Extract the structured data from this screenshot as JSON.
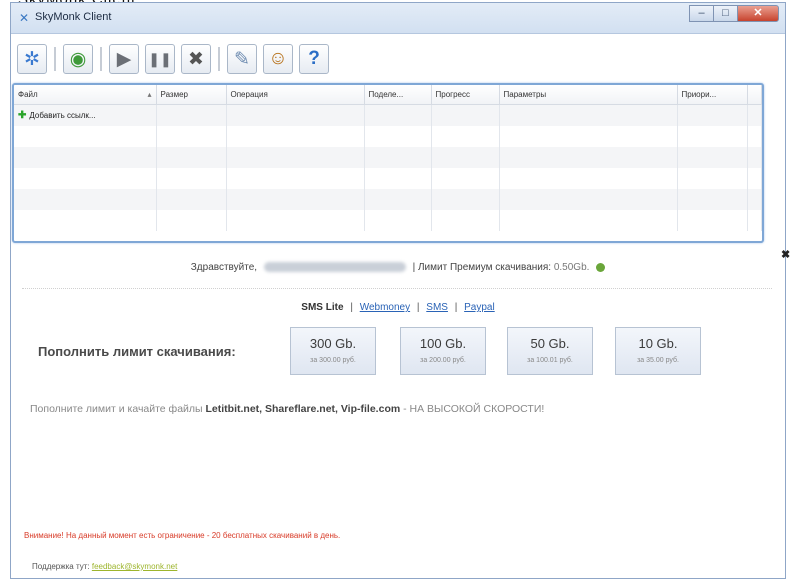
{
  "window": {
    "title": "SkyMonk Client"
  },
  "toolbar": {
    "buttons": [
      {
        "icon": "network-icon",
        "glyph": "✲"
      },
      {
        "icon": "globe-icon",
        "glyph": "◉"
      },
      {
        "icon": "play-icon",
        "glyph": "▶"
      },
      {
        "icon": "pause-icon",
        "glyph": "❚❚"
      },
      {
        "icon": "stop-icon",
        "glyph": "✖"
      },
      {
        "icon": "settings-icon",
        "glyph": "✎"
      },
      {
        "icon": "user-icon",
        "glyph": "☺"
      },
      {
        "icon": "help-icon",
        "glyph": "?"
      }
    ]
  },
  "table": {
    "columns": [
      "Файл",
      "Размер",
      "Операция",
      "Поделе...",
      "Прогресс",
      "Параметры",
      "Приори..."
    ],
    "add_link": "Добавить ссылк..."
  },
  "account": {
    "greeting": "Здравствуйте,",
    "separator": "|",
    "limit_label": "Лимит Премиум скачивания:",
    "limit_value": "0.50Gb."
  },
  "payment": {
    "selected": "SMS Lite",
    "links": [
      "Webmoney",
      "SMS",
      "Paypal"
    ]
  },
  "refill": {
    "label": "Пополнить лимит скачивания:",
    "packages": [
      {
        "amount": "300 Gb.",
        "price": "за 300.00 руб."
      },
      {
        "amount": "100 Gb.",
        "price": "за 200.00 руб."
      },
      {
        "amount": "50 Gb.",
        "price": "за 100.01 руб."
      },
      {
        "amount": "10 Gb.",
        "price": "за 35.00 руб."
      }
    ]
  },
  "promo": {
    "prefix": "Пополните лимит и качайте файлы",
    "sites": "Letitbit.net, Shareflare.net, Vip-file.com",
    "suffix": "- НА ВЫСОКОЙ СКОРОСТИ!"
  },
  "warning": "Внимание! На данный момент есть ограничение - 20 бесплатных скачиваний в день.",
  "support": {
    "label": "Поддержка тут:",
    "email": "feedback@skymonk.net"
  },
  "colors": {
    "warning": "#d83b28",
    "link": "#2a63b6",
    "support_link": "#9db52d",
    "grid_border": "#7fa7d6"
  }
}
